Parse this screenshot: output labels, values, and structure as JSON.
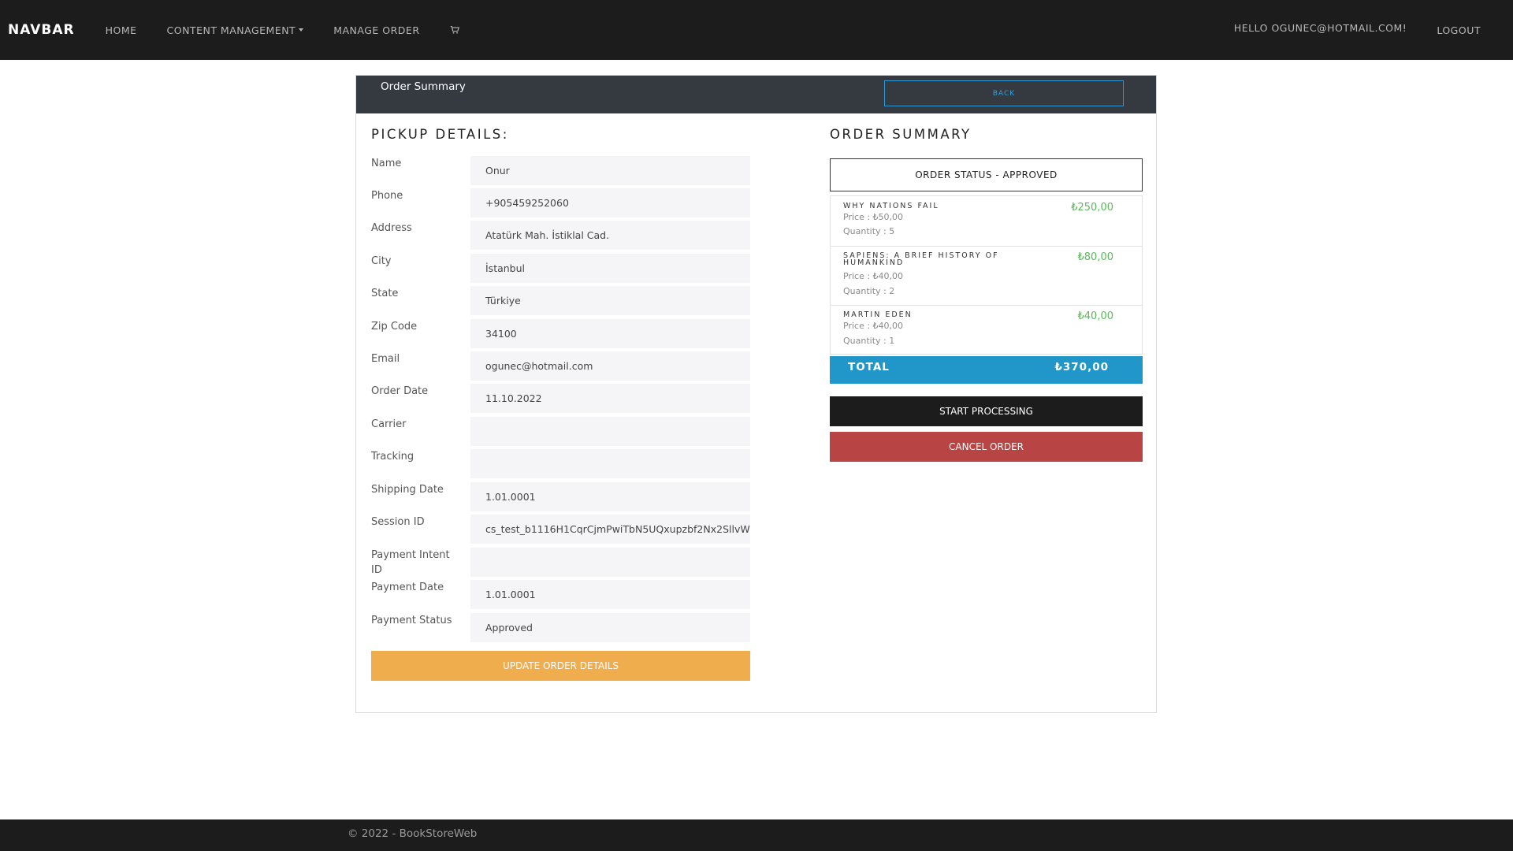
{
  "navbar": {
    "brand": "NAVBAR",
    "items": [
      {
        "label": "HOME"
      },
      {
        "label": "CONTENT MANAGEMENT"
      },
      {
        "label": "MANAGE ORDER"
      }
    ],
    "cart_icon": "cart-icon",
    "greeting": "HELLO OGUNEC@HOTMAIL.COM!",
    "logout": "LOGOUT"
  },
  "card": {
    "title": "Order Summary",
    "back_label": "BACK"
  },
  "pickup": {
    "title": "PICKUP DETAILS:",
    "fields": [
      {
        "label": "Name",
        "value": "Onur"
      },
      {
        "label": "Phone",
        "value": "+905459252060"
      },
      {
        "label": "Address",
        "value": "Atatürk Mah. İstiklal Cad."
      },
      {
        "label": "City",
        "value": "İstanbul"
      },
      {
        "label": "State",
        "value": "Türkiye"
      },
      {
        "label": "Zip Code",
        "value": "34100"
      },
      {
        "label": "Email",
        "value": "ogunec@hotmail.com"
      },
      {
        "label": "Order Date",
        "value": "11.10.2022"
      },
      {
        "label": "Carrier",
        "value": ""
      },
      {
        "label": "Tracking",
        "value": ""
      },
      {
        "label": "Shipping Date",
        "value": "1.01.0001"
      },
      {
        "label": "Session ID",
        "value": "cs_test_b1116H1CqrCjmPwiTbN5UQxupzbf2Nx2SllvW"
      },
      {
        "label": "Payment Intent ID",
        "value": ""
      },
      {
        "label": "Payment Date",
        "value": "1.01.0001"
      },
      {
        "label": "Payment Status",
        "value": "Approved"
      }
    ],
    "update_button": "UPDATE ORDER DETAILS"
  },
  "summary": {
    "title": "ORDER SUMMARY",
    "status": "ORDER STATUS - APPROVED",
    "items": [
      {
        "name": "WHY NATIONS FAIL",
        "price": "Price : ₺50,00",
        "quantity": "Quantity : 5",
        "total": "₺250,00"
      },
      {
        "name": "SAPIENS: A BRIEF HISTORY OF HUMANKIND",
        "price": "Price : ₺40,00",
        "quantity": "Quantity : 2",
        "total": "₺80,00"
      },
      {
        "name": "MARTIN EDEN",
        "price": "Price : ₺40,00",
        "quantity": "Quantity : 1",
        "total": "₺40,00"
      }
    ],
    "total_label": "TOTAL",
    "total_value": "₺370,00",
    "start_button": "START PROCESSING",
    "cancel_button": "CANCEL ORDER"
  },
  "footer": {
    "text": "© 2022 - BookStoreWeb"
  },
  "colors": {
    "navbar_bg": "#1c1c1c",
    "header_bg": "#343a40",
    "accent_blue": "#2196c9",
    "update_orange": "#f0ad4e",
    "cancel_red": "#b84444",
    "price_green": "#5cb85c"
  }
}
